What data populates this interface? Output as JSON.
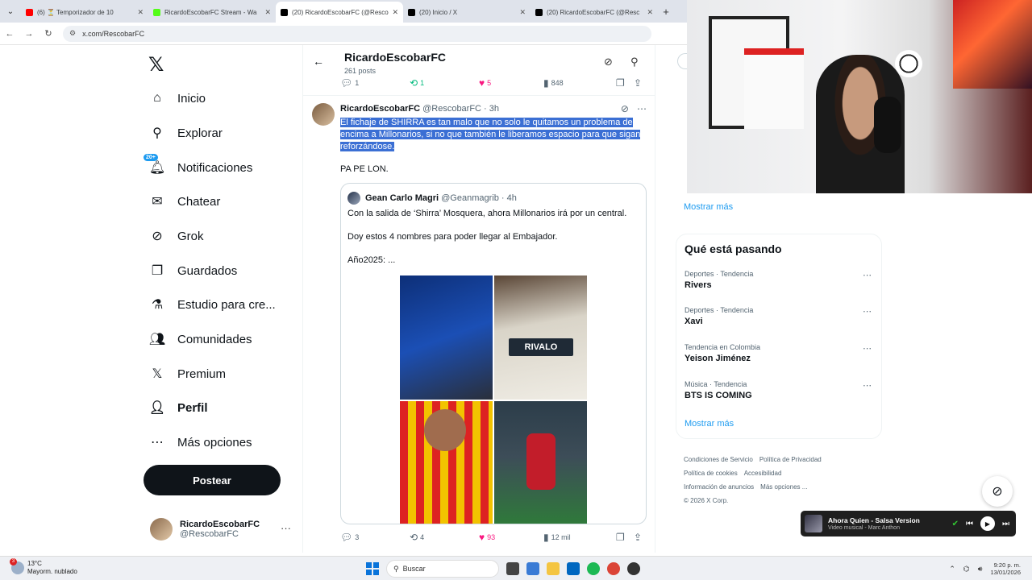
{
  "browser": {
    "tabs": [
      {
        "title": "(6) ⏳ Temporizador de 10",
        "favicon_color": "#ff0000",
        "active": false
      },
      {
        "title": "RicardoEscobarFC Stream - Wa",
        "favicon_color": "#53fc18",
        "active": false
      },
      {
        "title": "(20) RicardoEscobarFC (@Resco",
        "favicon_color": "#000000",
        "active": true
      },
      {
        "title": "(20) Inicio / X",
        "favicon_color": "#000000",
        "active": false
      },
      {
        "title": "(20) RicardoEscobarFC (@Resc",
        "favicon_color": "#000000",
        "active": false
      }
    ],
    "url": "x.com/RescobarFC",
    "new_tab": "+"
  },
  "nav": {
    "logo": "𝕏",
    "items": [
      {
        "label": "Inicio",
        "icon": "home-icon"
      },
      {
        "label": "Explorar",
        "icon": "search-icon"
      },
      {
        "label": "Notificaciones",
        "icon": "bell-icon",
        "badge": "20+"
      },
      {
        "label": "Chatear",
        "icon": "mail-icon"
      },
      {
        "label": "Grok",
        "icon": "grok-icon"
      },
      {
        "label": "Guardados",
        "icon": "bookmark-icon"
      },
      {
        "label": "Estudio para cre...",
        "icon": "flask-icon"
      },
      {
        "label": "Comunidades",
        "icon": "communities-icon"
      },
      {
        "label": "Premium",
        "icon": "x-premium-icon"
      },
      {
        "label": "Perfil",
        "icon": "person-icon",
        "bold": true
      },
      {
        "label": "Más opciones",
        "icon": "more-icon"
      }
    ],
    "post_button": "Postear",
    "profile": {
      "name": "RicardoEscobarFC",
      "handle": "@RescobarFC",
      "menu": "···"
    }
  },
  "header": {
    "title": "RicardoEscobarFC",
    "posts": "261 posts"
  },
  "prev_tweet_actions": {
    "replies": "1",
    "retweets": "1",
    "likes": "5",
    "views": "848"
  },
  "tweet": {
    "name": "RicardoEscobarFC",
    "handle_time": "@RescobarFC · 3h",
    "text": "El fichaje de SHIRRA es tan malo que no solo le quitamos un problema de encima a Millonarios, si no que también le liberamos espacio para que sigan reforzándose.",
    "extra": "PA PE LON.",
    "quote": {
      "name": "Gean Carlo Magri",
      "handle_time": "@Geanmagrib · 4h",
      "line1": "Con la salida de ‘Shirra’ Mosquera,  ahora Millonarios irá por un central.",
      "line2": "Doy estos 4 nombres para poder llegar al Embajador.",
      "line3": "Año2025: ...",
      "image_brand": "RIVALO"
    },
    "actions": {
      "replies": "3",
      "retweets": "4",
      "likes": "93",
      "views": "12 mil"
    }
  },
  "sidebar": {
    "show_more_top": "Mostrar más",
    "trending_title": "Qué está pasando",
    "trends": [
      {
        "category": "Deportes · Tendencia",
        "name": "Rivers"
      },
      {
        "category": "Deportes · Tendencia",
        "name": "Xavi"
      },
      {
        "category": "Tendencia en Colombia",
        "name": "Yeison Jiménez"
      },
      {
        "category": "Música · Tendencia",
        "name": "BTS IS COMING"
      }
    ],
    "show_more": "Mostrar más",
    "footer": [
      "Condiciones de Servicio",
      "Política de Privacidad",
      "Política de cookies",
      "Accesibilidad",
      "Información de anuncios",
      "Más opciones ...",
      "© 2026 X Corp."
    ]
  },
  "media": {
    "title": "Ahora Quien - Salsa Version",
    "subtitle": "Video musical - Marc Anthon"
  },
  "taskbar": {
    "temp": "13°C",
    "weather": "Mayorm. nublado",
    "weather_badge": "3",
    "search": "Buscar",
    "time": "9:20 p. m.",
    "date": "13/01/2026"
  }
}
